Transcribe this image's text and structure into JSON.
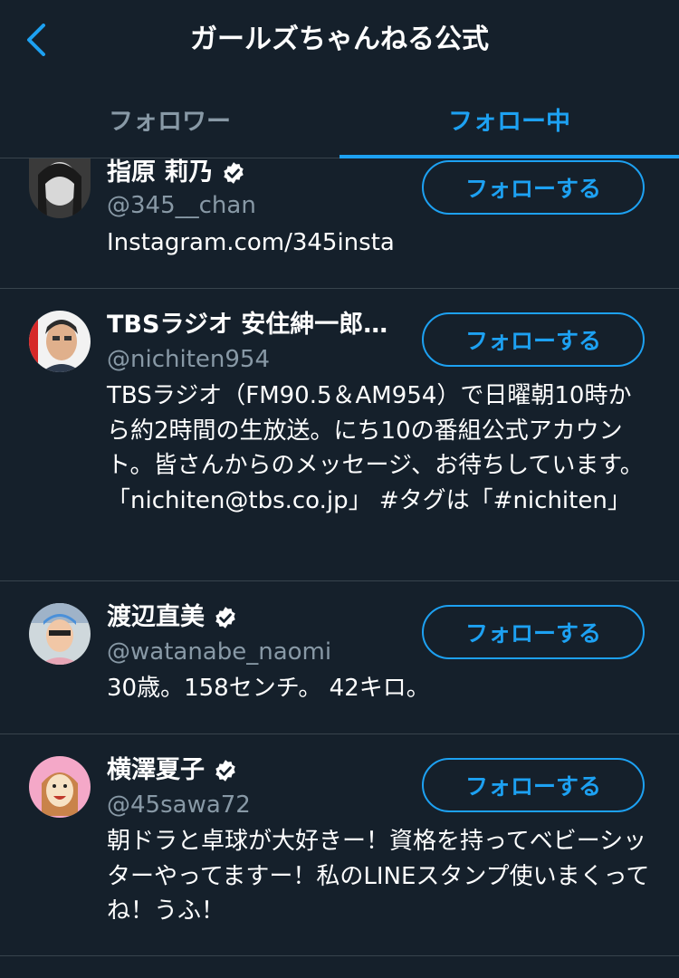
{
  "header": {
    "title": "ガールズちゃんねる公式"
  },
  "tabs": [
    {
      "label": "フォロワー"
    },
    {
      "label": "フォロー中"
    }
  ],
  "accent_color": "#1da1f2",
  "users": [
    {
      "name": "指原 莉乃",
      "verified": true,
      "handle": "@345__chan",
      "bio": "Instagram.com/345insta",
      "button": "フォローする"
    },
    {
      "name": "TBSラジオ 安住紳一郎…",
      "verified": false,
      "handle": "@nichiten954",
      "bio": "TBSラジオ（FM90.5＆AM954）で日曜朝10時から約2時間の生放送。にち10の番組公式アカウント。皆さんからのメッセージ、お待ちしています。「nichiten@tbs.co.jp」 #タグは「#nichiten」",
      "button": "フォローする"
    },
    {
      "name": "渡辺直美",
      "verified": true,
      "handle": "@watanabe_naomi",
      "bio": "30歳。158センチ。 42キロ。",
      "button": "フォローする"
    },
    {
      "name": "横澤夏子",
      "verified": true,
      "handle": "@45sawa72",
      "bio": "朝ドラと卓球が大好きー！資格を持ってベビーシッターやってますー！私のLINEスタンプ使いまくってね！うふ！",
      "button": "フォローする"
    }
  ]
}
